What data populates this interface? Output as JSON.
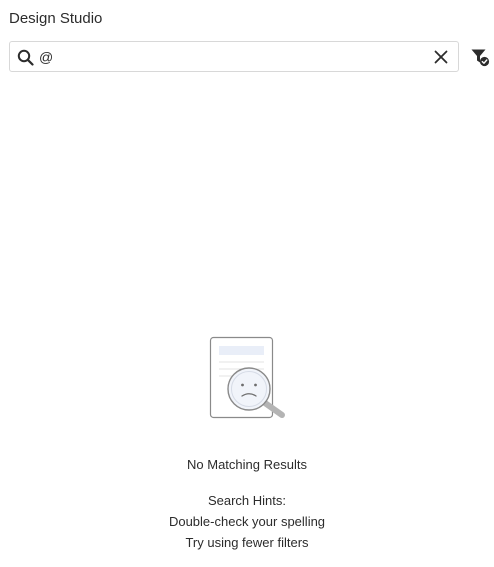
{
  "app": {
    "title": "Design Studio"
  },
  "search": {
    "value": "@"
  },
  "icons": {
    "search": "search-icon",
    "clear": "close-icon",
    "filter": "filter-check-icon",
    "empty_state": "document-magnifier-sad-icon"
  },
  "empty_state": {
    "message": "No Matching Results",
    "hints_title": "Search Hints:",
    "hints": [
      "Double-check your spelling",
      "Try using fewer filters"
    ]
  },
  "colors": {
    "text": "#2c2c2c",
    "border": "#d8d8d8",
    "illustration_stroke": "#8a8a8a",
    "illustration_fill": "#e9eef8"
  }
}
